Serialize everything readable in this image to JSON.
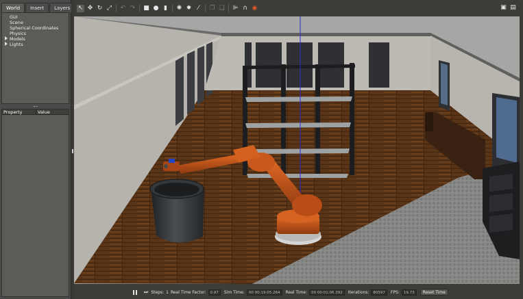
{
  "left_panel": {
    "tabs": [
      "World",
      "Insert",
      "Layers"
    ],
    "tree_items": [
      {
        "label": "GUI",
        "expandable": false
      },
      {
        "label": "Scene",
        "expandable": false
      },
      {
        "label": "Spherical Coordinates",
        "expandable": false
      },
      {
        "label": "Physics",
        "expandable": false
      },
      {
        "label": "Models",
        "expandable": true
      },
      {
        "label": "Lights",
        "expandable": true
      }
    ],
    "property_header": "Property",
    "value_header": "Value"
  },
  "toolbar": {
    "tools": [
      {
        "icon": "select-arrow-icon",
        "glyph": "↖",
        "selected": true
      },
      {
        "icon": "translate-icon",
        "glyph": "✥"
      },
      {
        "icon": "rotate-icon",
        "glyph": "↻"
      },
      {
        "icon": "scale-icon",
        "glyph": "⤢"
      },
      {
        "icon": "undo-icon",
        "glyph": "↶",
        "dim": true
      },
      {
        "icon": "redo-icon",
        "glyph": "↷",
        "dim": true
      },
      {
        "icon": "box-shape-icon",
        "glyph": "■"
      },
      {
        "icon": "sphere-shape-icon",
        "glyph": "●"
      },
      {
        "icon": "cylinder-shape-icon",
        "glyph": "▮"
      },
      {
        "icon": "point-light-icon",
        "glyph": "✺"
      },
      {
        "icon": "spot-light-icon",
        "glyph": "✹"
      },
      {
        "icon": "directional-light-icon",
        "glyph": "⁄"
      },
      {
        "icon": "copy-icon",
        "glyph": "❐",
        "dim": true
      },
      {
        "icon": "paste-icon",
        "glyph": "❑",
        "dim": true
      },
      {
        "icon": "align-icon",
        "glyph": "⊫"
      },
      {
        "icon": "snap-icon",
        "glyph": "∩"
      },
      {
        "icon": "change-view-icon",
        "glyph": "◉",
        "accent": true
      }
    ],
    "right_icons": [
      {
        "icon": "screenshot-camera-icon",
        "glyph": "▣"
      },
      {
        "icon": "log-icon",
        "glyph": "▤"
      }
    ],
    "accent_color": "#e05a2a"
  },
  "bottom_bar": {
    "steps_label": "Steps:",
    "steps_value": "1",
    "real_time_factor_label": "Real Time Factor:",
    "real_time_factor_value": "0.97",
    "sim_time_label": "Sim Time:",
    "sim_time_value": "00 00:19:05.264",
    "real_time_label": "Real Time:",
    "real_time_value": "00 00:01:06.392",
    "iterations_label": "Iterations:",
    "iterations_value": "80597",
    "fps_label": "FPS:",
    "fps_value": "19.73",
    "reset_time_label": "Reset Time"
  },
  "scene": {
    "floor_color": "#5a3416",
    "wall_color": "#b9b7b0",
    "robot_color": "#c0571d",
    "bin_color": "#2e3133",
    "axis_color": "#2a2ad0",
    "ground_color": "#8b8b8b"
  }
}
